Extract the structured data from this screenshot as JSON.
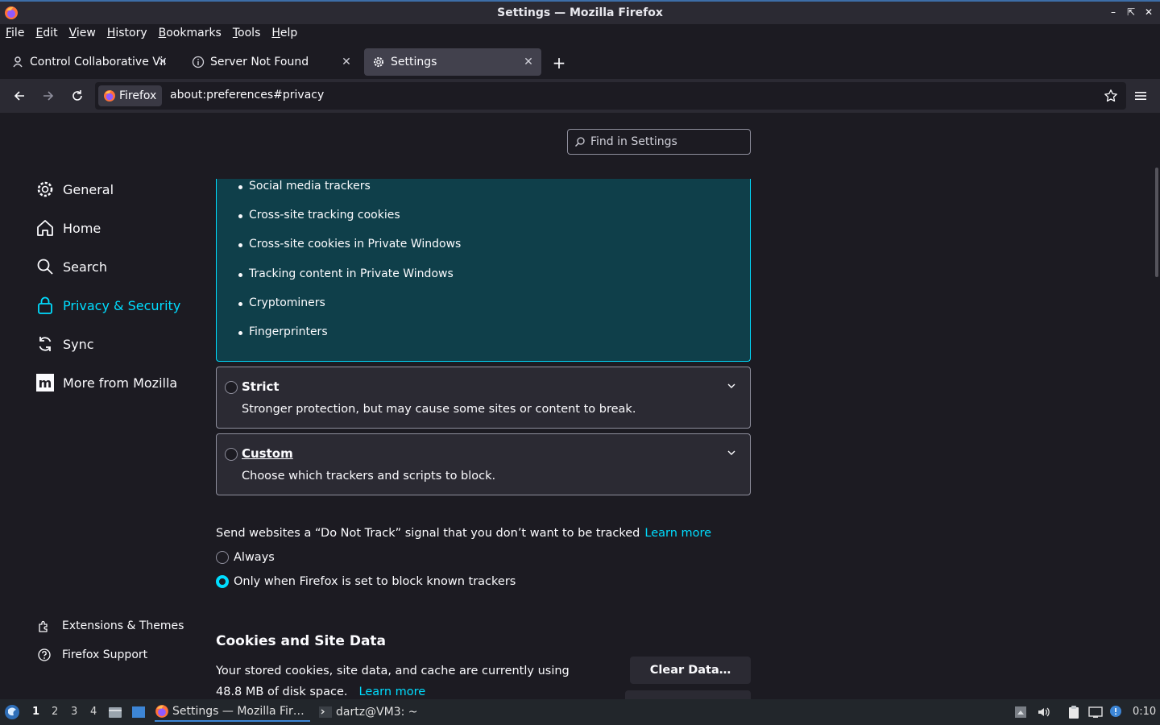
{
  "window": {
    "title": "Settings — Mozilla Firefox"
  },
  "menubar": {
    "items": [
      {
        "u": "F",
        "rest": "ile"
      },
      {
        "u": "E",
        "rest": "dit"
      },
      {
        "u": "V",
        "rest": "iew"
      },
      {
        "u": "H",
        "rest": "istory"
      },
      {
        "u": "B",
        "rest": "ookmarks"
      },
      {
        "u": "T",
        "rest": "ools"
      },
      {
        "u": "H",
        "rest": "elp"
      }
    ]
  },
  "tabs": [
    {
      "label": "Control Collaborative Virt",
      "active": false
    },
    {
      "label": "Server Not Found",
      "active": false
    },
    {
      "label": "Settings",
      "active": true
    }
  ],
  "navbar": {
    "identity_label": "Firefox",
    "url": "about:preferences#privacy"
  },
  "search": {
    "placeholder": "Find in Settings"
  },
  "sidebar": {
    "items": [
      {
        "label": "General"
      },
      {
        "label": "Home"
      },
      {
        "label": "Search"
      },
      {
        "label": "Privacy & Security"
      },
      {
        "label": "Sync"
      },
      {
        "label": "More from Mozilla"
      }
    ],
    "footer": [
      {
        "label": "Extensions & Themes"
      },
      {
        "label": "Firefox Support"
      }
    ]
  },
  "standard": {
    "bullets": [
      "Social media trackers",
      "Cross-site tracking cookies",
      "Cross-site cookies in Private Windows",
      "Tracking content in Private Windows",
      "Cryptominers",
      "Fingerprinters"
    ]
  },
  "strict": {
    "title": "Strict",
    "desc": "Stronger protection, but may cause some sites or content to break."
  },
  "custom": {
    "title": "Custom",
    "desc": "Choose which trackers and scripts to block."
  },
  "dnt": {
    "text": "Send websites a “Do Not Track” signal that you don’t want to be tracked",
    "learn_more": "Learn more",
    "options": [
      {
        "label": "Always",
        "checked": false
      },
      {
        "label": "Only when Firefox is set to block known trackers",
        "checked": true
      }
    ]
  },
  "cookies": {
    "title": "Cookies and Site Data",
    "text_prefix": "Your stored cookies, site data, and cache are currently using 48.8 MB of disk space.",
    "learn_more": "Learn more",
    "clear_button": "Clear Data…"
  },
  "taskbar": {
    "workspaces": [
      "1",
      "2",
      "3",
      "4"
    ],
    "apps": [
      {
        "label": "Settings — Mozilla Fir…"
      },
      {
        "label": "dartz@VM3: ~"
      }
    ],
    "clock": "0:10"
  },
  "colors": {
    "accent": "#00ddff",
    "background": "#1c1b22",
    "surface": "#2b2a33"
  }
}
